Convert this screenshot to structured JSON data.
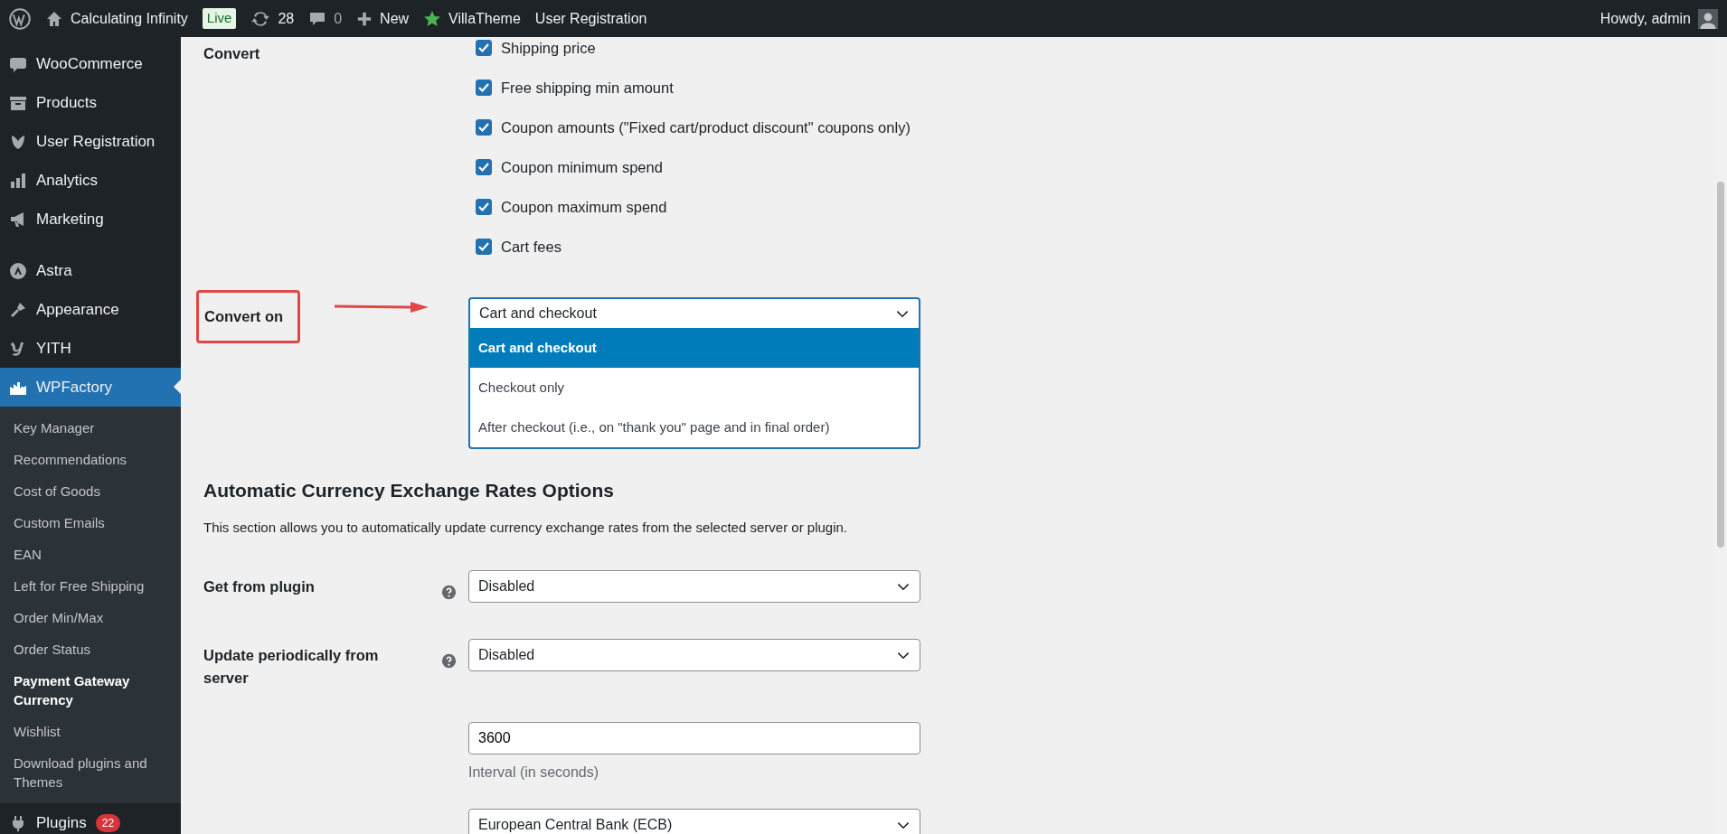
{
  "admin_bar": {
    "site_name": "Calculating Infinity",
    "live_badge": "Live",
    "updates_count": "28",
    "comments_count": "0",
    "new_label": "New",
    "items": [
      {
        "label": "VillaTheme",
        "kind": "star"
      },
      {
        "label": "User Registration",
        "kind": "plain"
      }
    ],
    "greeting": "Howdy, admin"
  },
  "sidebar": {
    "groups": [
      [
        {
          "label": "WooCommerce",
          "kind": "woo",
          "selected": false
        },
        {
          "label": "Products",
          "kind": "archive",
          "selected": false
        },
        {
          "label": "User Registration",
          "kind": "leaf",
          "selected": false
        },
        {
          "label": "Analytics",
          "kind": "bars",
          "selected": false
        },
        {
          "label": "Marketing",
          "kind": "megaphone",
          "selected": false
        }
      ],
      [
        {
          "label": "Astra",
          "kind": "circle",
          "selected": false
        },
        {
          "label": "Appearance",
          "kind": "brush",
          "selected": false
        },
        {
          "label": "YITH",
          "kind": "script",
          "selected": false
        },
        {
          "label": "WPFactory",
          "kind": "factory",
          "selected": true
        }
      ]
    ],
    "submenu": [
      {
        "label": "Key Manager",
        "selected": false
      },
      {
        "label": "Recommendations",
        "selected": false
      },
      {
        "label": "Cost of Goods",
        "selected": false
      },
      {
        "label": "Custom Emails",
        "selected": false
      },
      {
        "label": "EAN",
        "selected": false
      },
      {
        "label": "Left for Free Shipping",
        "selected": false
      },
      {
        "label": "Order Min/Max",
        "selected": false
      },
      {
        "label": "Order Status",
        "selected": false
      },
      {
        "label": "Payment Gateway Currency",
        "selected": true
      },
      {
        "label": "Wishlist",
        "selected": false
      },
      {
        "label": "Download plugins and Themes",
        "selected": false
      }
    ],
    "after": [
      {
        "label": "Plugins",
        "kind": "plug",
        "badge": "22"
      }
    ]
  },
  "convert": {
    "label": "Convert",
    "options": [
      {
        "label": "Shipping price",
        "checked": true
      },
      {
        "label": "Free shipping min amount",
        "checked": true
      },
      {
        "label": "Coupon amounts (\"Fixed cart/product discount\" coupons only)",
        "checked": true
      },
      {
        "label": "Coupon minimum spend",
        "checked": true
      },
      {
        "label": "Coupon maximum spend",
        "checked": true
      },
      {
        "label": "Cart fees",
        "checked": true
      }
    ]
  },
  "convert_on": {
    "label": "Convert on",
    "highlighted": true,
    "value": "Cart and checkout",
    "expanded": true,
    "options": [
      {
        "label": "Cart and checkout",
        "selected": true
      },
      {
        "label": "Checkout only",
        "selected": false
      },
      {
        "label": "After checkout (i.e., on \"thank you\" page and in final order)",
        "selected": false
      }
    ]
  },
  "section": {
    "title": "Automatic Currency Exchange Rates Options",
    "description": "This section allows you to automatically update currency exchange rates from the selected server or plugin."
  },
  "fields": [
    {
      "kind": "select",
      "label": "Get from plugin",
      "help": true,
      "value": "Disabled"
    },
    {
      "kind": "select",
      "label": "Update periodically from server",
      "help": true,
      "value": "Disabled"
    },
    {
      "kind": "input",
      "value": "3600",
      "hint": "Interval (in seconds)"
    },
    {
      "kind": "select",
      "value": "European Central Bank (ECB)"
    }
  ]
}
